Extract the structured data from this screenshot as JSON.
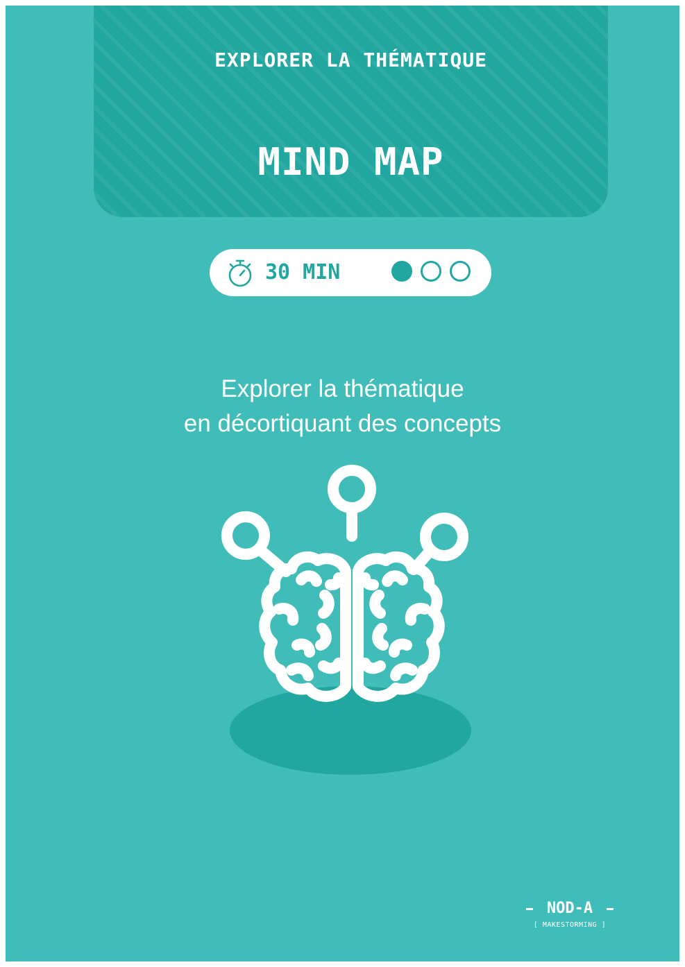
{
  "header": {
    "category": "EXPLORER LA THÉMATIQUE",
    "title": "MIND MAP"
  },
  "info": {
    "duration": "30 MIN",
    "duration_icon": "stopwatch-icon",
    "difficulty_level": 1,
    "difficulty_max": 3
  },
  "description": {
    "line1": "Explorer la thématique",
    "line2": "en décortiquant des concepts"
  },
  "illustration": {
    "icon": "brain-mind-map-icon"
  },
  "footer": {
    "logo_name": "NOD-A",
    "logo_tagline": "[ MAKESTORMING ]"
  },
  "colors": {
    "background": "#41bdb9",
    "accent_dark": "#22a7a0",
    "text": "#ffffff"
  }
}
